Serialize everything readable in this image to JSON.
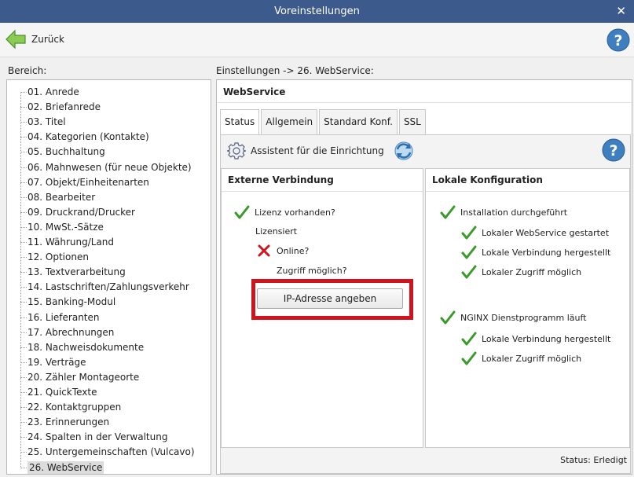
{
  "window": {
    "title": "Voreinstellungen",
    "close_glyph": "✕"
  },
  "toolbar": {
    "back_label": "Zurück",
    "back_icon": "green-arrow-left-icon",
    "help_icon": "help-circle-icon"
  },
  "left": {
    "label": "Bereich:",
    "items": [
      "01. Anrede",
      "02. Briefanrede",
      "03. Titel",
      "04. Kategorien (Kontakte)",
      "05. Buchhaltung",
      "06. Mahnwesen (für neue Objekte)",
      "07. Objekt/Einheitenarten",
      "08. Bearbeiter",
      "09. Druckrand/Drucker",
      "10. MwSt.-Sätze",
      "11. Währung/Land",
      "12. Optionen",
      "13. Textverarbeitung",
      "14. Lastschriften/Zahlungsverkehr",
      "15. Banking-Modul",
      "16. Lieferanten",
      "17. Abrechnungen",
      "18. Nachweisdokumente",
      "19. Verträge",
      "20. Zähler Montageorte",
      "21. QuickTexte",
      "22. Kontaktgruppen",
      "23. Erinnerungen",
      "24. Spalten in der Verwaltung",
      "25. Untergemeinschaften (Vulcavo)",
      "26. WebService"
    ],
    "selected_index": 25
  },
  "main": {
    "breadcrumb": "Einstellungen -> 26. WebService:",
    "title": "WebService",
    "tabs": [
      "Status",
      "Allgemein",
      "Standard Konf.",
      "SSL"
    ],
    "active_tab": 0,
    "assistant_label": "Assistent für die Einrichtung",
    "external": {
      "heading": "Externe Verbindung",
      "license": "Lizenz vorhanden?",
      "licensed": "Lizensiert",
      "online": "Online?",
      "access": "Zugriff möglich?",
      "ip_button": "IP-Adresse angeben"
    },
    "local": {
      "heading": "Lokale Konfiguration",
      "install": "Installation durchgeführt",
      "ws_started": "Lokaler WebService gestartet",
      "conn1": "Lokale Verbindung hergestellt",
      "access1": "Lokaler Zugriff möglich",
      "nginx": "NGINX Dienstprogramm läuft",
      "conn2": "Lokale Verbindung hergestellt",
      "access2": "Lokaler Zugriff möglich"
    },
    "status_text": "Status: Erledigt"
  },
  "colors": {
    "titlebar": "#3d5a8c",
    "check": "#3a9a2a",
    "cross": "#d0141e",
    "highlight": "#d0141e",
    "help": "#3f7fc0"
  }
}
